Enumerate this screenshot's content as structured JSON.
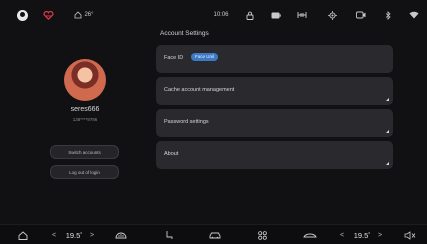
{
  "status": {
    "temperature": "26°",
    "time": "10:06"
  },
  "icons": {
    "home": "home-icon",
    "wifi": "wifi-icon",
    "heart": "heart-icon"
  },
  "profile": {
    "username": "seres666",
    "user_id": "138****9786",
    "switch_label": "Switch accounts",
    "logout_label": "Log out of login"
  },
  "settings": {
    "section_title": "Account Settings",
    "items": [
      {
        "label": "Face ID",
        "badge": "Face Unil"
      },
      {
        "label": "Cache account management"
      },
      {
        "label": "Password settings"
      },
      {
        "label": "About"
      }
    ]
  },
  "climate": {
    "left_temp": "19.5",
    "right_temp": "19.5",
    "left_arrow": "<",
    "right_arrow": ">",
    "degree": "°"
  },
  "colors": {
    "accent": "#3d7ac6",
    "card": "#2a2a2e",
    "background": "#111114"
  }
}
